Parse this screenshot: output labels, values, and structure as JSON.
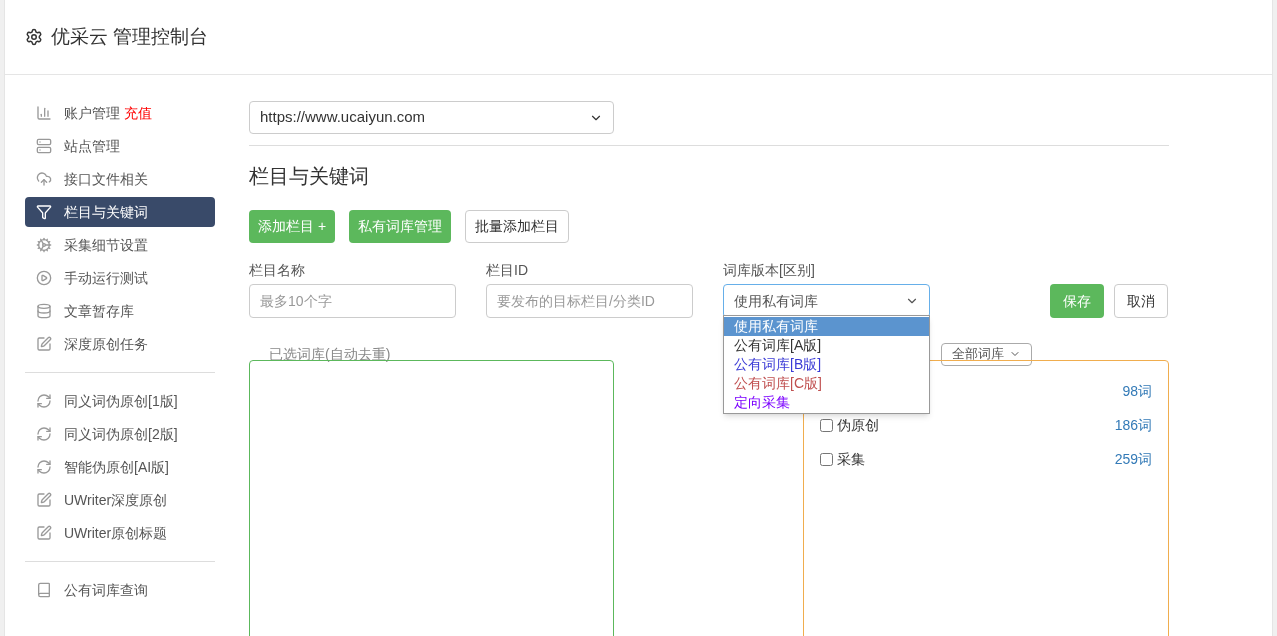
{
  "header": {
    "title": "优采云 管理控制台"
  },
  "sidebar": {
    "groups": [
      {
        "items": [
          {
            "label": "账户管理",
            "badge": "充值",
            "kind": "chart",
            "selected": false
          },
          {
            "label": "站点管理",
            "kind": "server",
            "selected": false
          },
          {
            "label": "接口文件相关",
            "kind": "cloud",
            "selected": false
          },
          {
            "label": "栏目与关键词",
            "kind": "filter",
            "selected": true
          },
          {
            "label": "采集细节设置",
            "kind": "gears",
            "selected": false
          },
          {
            "label": "手动运行测试",
            "kind": "play",
            "selected": false
          },
          {
            "label": "文章暂存库",
            "kind": "db",
            "selected": false
          },
          {
            "label": "深度原创任务",
            "kind": "edit",
            "selected": false
          }
        ]
      },
      {
        "items": [
          {
            "label": "同义词伪原创[1版]",
            "kind": "refresh",
            "selected": false
          },
          {
            "label": "同义词伪原创[2版]",
            "kind": "refresh",
            "selected": false
          },
          {
            "label": "智能伪原创[AI版]",
            "kind": "refresh",
            "selected": false
          },
          {
            "label": "UWriter深度原创",
            "kind": "edit",
            "selected": false
          },
          {
            "label": "UWriter原创标题",
            "kind": "edit",
            "selected": false
          }
        ]
      },
      {
        "items": [
          {
            "label": "公有词库查询",
            "kind": "book",
            "selected": false
          }
        ]
      }
    ]
  },
  "site_select": {
    "value": "https://www.ucaiyun.com"
  },
  "section_title": "栏目与关键词",
  "actions": [
    {
      "label": "添加栏目 +",
      "kind": "primary"
    },
    {
      "label": "私有词库管理",
      "kind": "primary"
    },
    {
      "label": "批量添加栏目",
      "kind": "default"
    }
  ],
  "form": {
    "fields": [
      {
        "label": "栏目名称",
        "placeholder": "最多10个字"
      },
      {
        "label": "栏目ID",
        "placeholder": "要发布的目标栏目/分类ID"
      }
    ],
    "library": {
      "label": "词库版本[区别]",
      "value": "使用私有词库",
      "options": [
        {
          "label": "使用私有词库",
          "selected": true
        },
        {
          "label": "公有词库[A版]",
          "selected": false,
          "color": "#333333"
        },
        {
          "label": "公有词库[B版]",
          "selected": false,
          "color": "#3b3bd6"
        },
        {
          "label": "公有词库[C版]",
          "selected": false,
          "color": "#c05050"
        },
        {
          "label": "定向采集",
          "selected": false,
          "color": "#7b00ff"
        }
      ]
    },
    "save": "保存",
    "cancel": "取消"
  },
  "selected_label": "已选词库(自动去重)",
  "filter_select": {
    "value": "全部词库"
  },
  "libraries": [
    {
      "count": "98词"
    },
    {
      "label": "伪原创",
      "count": "186词",
      "checked": false
    },
    {
      "label": "采集",
      "count": "259词",
      "checked": false
    }
  ]
}
